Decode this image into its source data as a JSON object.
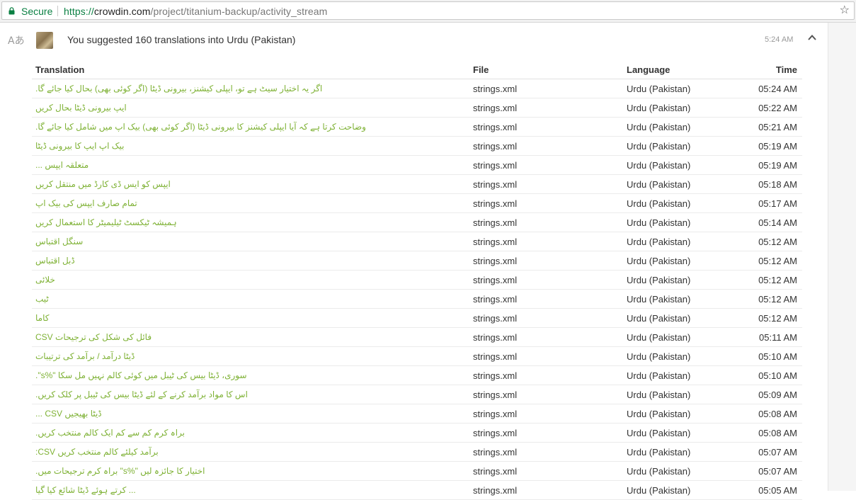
{
  "browser": {
    "secure_label": "Secure",
    "url_scheme": "https://",
    "url_host": "crowdin.com",
    "url_path": "/project/titanium-backup/activity_stream",
    "bookmark_icon": "star-icon",
    "secure_color": "#0b8043"
  },
  "activity": {
    "icon": "translate-icon",
    "icon_glyph": "Aあ",
    "headline": "You suggested 160 translations into Urdu (Pakistan)",
    "time": "5:24 AM",
    "collapse_icon": "chevron-up-icon"
  },
  "table": {
    "headers": {
      "translation": "Translation",
      "file": "File",
      "language": "Language",
      "time": "Time"
    },
    "translation_color": "#7fb236",
    "rows": [
      {
        "translation": "اگر یہ اختیار سیٹ ہے تو، ایپلی کیشنز، بیرونی ڈیٹا (اگر کوئی بھی) بحال کیا جائے گا.",
        "file": "strings.xml",
        "language": "Urdu (Pakistan)",
        "time": "05:24 AM"
      },
      {
        "translation": "ایپ بیرونی ڈیٹا بحال کریں",
        "file": "strings.xml",
        "language": "Urdu (Pakistan)",
        "time": "05:22 AM"
      },
      {
        "translation": "وضاحت کرتا ہے کہ آیا ایپلی کیشنز کا بیرونی ڈیٹا (اگر کوئی بھی) بیک اپ میں شامل کیا جائے گا.",
        "file": "strings.xml",
        "language": "Urdu (Pakistan)",
        "time": "05:21 AM"
      },
      {
        "translation": "بیک اپ ایپ کا بیرونی ڈیٹا",
        "file": "strings.xml",
        "language": "Urdu (Pakistan)",
        "time": "05:19 AM"
      },
      {
        "translation": "متعلقہ ایپس ...",
        "file": "strings.xml",
        "language": "Urdu (Pakistan)",
        "time": "05:19 AM"
      },
      {
        "translation": "ایپس کو ایس ڈی کارڈ میں منتقل کریں",
        "file": "strings.xml",
        "language": "Urdu (Pakistan)",
        "time": "05:18 AM"
      },
      {
        "translation": "تمام صارف ایپس کی بیک اپ",
        "file": "strings.xml",
        "language": "Urdu (Pakistan)",
        "time": "05:17 AM"
      },
      {
        "translation": "ہمیشہ ٹیکسٹ ٹیلیمیٹر کا استعمال کریں",
        "file": "strings.xml",
        "language": "Urdu (Pakistan)",
        "time": "05:14 AM"
      },
      {
        "translation": "سنگل اقتباس",
        "file": "strings.xml",
        "language": "Urdu (Pakistan)",
        "time": "05:12 AM"
      },
      {
        "translation": "ڈبل اقتباس",
        "file": "strings.xml",
        "language": "Urdu (Pakistan)",
        "time": "05:12 AM"
      },
      {
        "translation": "خلائی",
        "file": "strings.xml",
        "language": "Urdu (Pakistan)",
        "time": "05:12 AM"
      },
      {
        "translation": "ٹیب",
        "file": "strings.xml",
        "language": "Urdu (Pakistan)",
        "time": "05:12 AM"
      },
      {
        "translation": "کاما",
        "file": "strings.xml",
        "language": "Urdu (Pakistan)",
        "time": "05:12 AM"
      },
      {
        "translation": "فائل کی شکل کی ترجیحات CSV",
        "file": "strings.xml",
        "language": "Urdu (Pakistan)",
        "time": "05:11 AM"
      },
      {
        "translation": "ڈیٹا درآمد / برآمد کی ترتیبات",
        "file": "strings.xml",
        "language": "Urdu (Pakistan)",
        "time": "05:10 AM"
      },
      {
        "translation": "سوری، ڈیٹا بیس کی ٹیبل میں کوئی کالم نہیں مل سکا \"%s\".",
        "file": "strings.xml",
        "language": "Urdu (Pakistan)",
        "time": "05:10 AM"
      },
      {
        "translation": "اس کا مواد برآمد کرنے کے لئے ڈیٹا بیس کی ٹیبل پر کلک کریں.",
        "file": "strings.xml",
        "language": "Urdu (Pakistan)",
        "time": "05:09 AM"
      },
      {
        "translation": "ڈیٹا بھیجیں CSV ...",
        "file": "strings.xml",
        "language": "Urdu (Pakistan)",
        "time": "05:08 AM"
      },
      {
        "translation": "براہ کرم کم سے کم ایک کالم منتخب کریں.",
        "file": "strings.xml",
        "language": "Urdu (Pakistan)",
        "time": "05:08 AM"
      },
      {
        "translation": "برآمد کیلئے کالم منتخب کریں CSV:",
        "file": "strings.xml",
        "language": "Urdu (Pakistan)",
        "time": "05:07 AM"
      },
      {
        "translation": "اختیار کا جائزہ لیں \"%s\" براہ کرم ترجیحات میں.",
        "file": "strings.xml",
        "language": "Urdu (Pakistan)",
        "time": "05:07 AM"
      },
      {
        "translation": "... کرتے ہوئے ڈیٹا شائع کیا گیا",
        "file": "strings.xml",
        "language": "Urdu (Pakistan)",
        "time": "05:05 AM"
      }
    ]
  }
}
